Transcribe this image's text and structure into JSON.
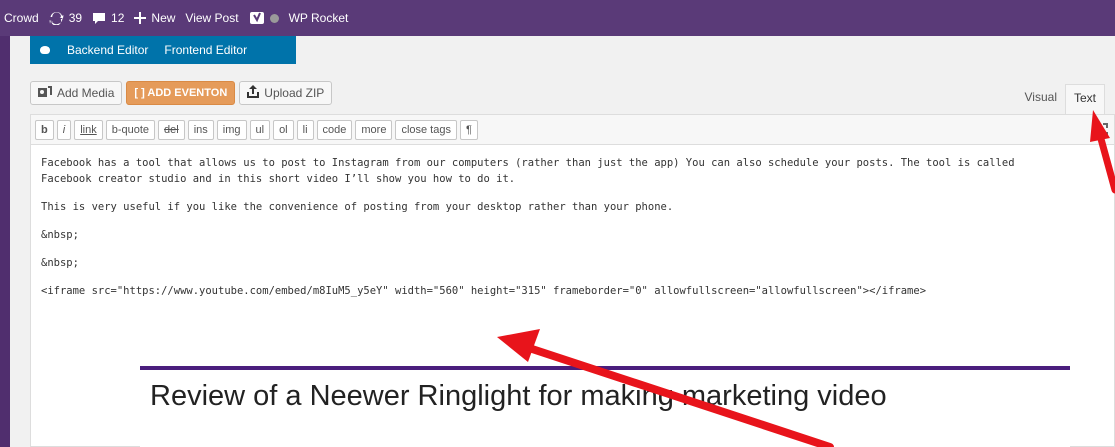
{
  "adminbar": {
    "site_label": "Crowd",
    "updates_count": "39",
    "comments_count": "12",
    "new_label": "New",
    "view_post_label": "View Post",
    "wp_rocket_label": "WP Rocket"
  },
  "builder": {
    "backend_label": "Backend Editor",
    "frontend_label": "Frontend Editor"
  },
  "media_buttons": {
    "add_media": "Add Media",
    "add_eventon": "[ ] ADD EVENTON",
    "upload_zip": "Upload ZIP"
  },
  "tabs": {
    "visual": "Visual",
    "text": "Text"
  },
  "quicktags": [
    "b",
    "i",
    "link",
    "b-quote",
    "del",
    "ins",
    "img",
    "ul",
    "ol",
    "li",
    "code",
    "more",
    "close tags",
    "¶"
  ],
  "content": {
    "paragraph_1": "Facebook has a tool that allows us to post to Instagram from our computers (rather than just the app) You can also schedule your posts. The tool is called\nFacebook creator studio and in this short video I’ll show you how to do it.",
    "paragraph_2": "This is very useful if you like the convenience of posting from your desktop rather than your phone.",
    "nbsp_1": "&nbsp;",
    "nbsp_2": "&nbsp;",
    "iframe_code": "<iframe src=\"https://www.youtube.com/embed/m8IuM5_y5eY\" width=\"560\" height=\"315\" frameborder=\"0\" allowfullscreen=\"allowfullscreen\"></iframe>"
  },
  "thumbnail": {
    "title": "Review of a Neewer Ringlight for making marketing video"
  },
  "colors": {
    "adminbar": "#5a3a78",
    "builder_button": "#0073aa",
    "eventon_button": "#e59b5a",
    "arrow": "#e8141b"
  }
}
